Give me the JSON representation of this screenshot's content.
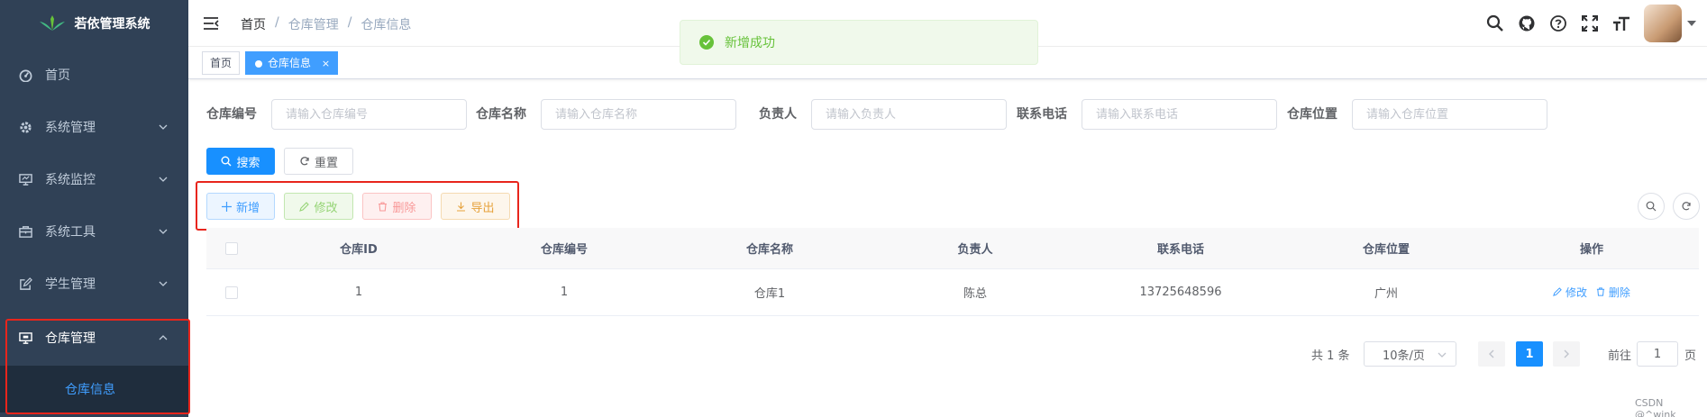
{
  "app": {
    "title": "若依管理系统"
  },
  "sidebar": {
    "items": [
      {
        "label": "首页",
        "icon": "dashboard-icon"
      },
      {
        "label": "系统管理",
        "icon": "gear-icon"
      },
      {
        "label": "系统监控",
        "icon": "monitor-icon"
      },
      {
        "label": "系统工具",
        "icon": "toolbox-icon"
      },
      {
        "label": "学生管理",
        "icon": "edit-icon"
      },
      {
        "label": "仓库管理",
        "icon": "monitor-icon"
      }
    ],
    "submenu": {
      "label": "仓库信息"
    }
  },
  "header": {
    "breadcrumb": [
      "首页",
      "仓库管理",
      "仓库信息"
    ],
    "separator": "/"
  },
  "tags": [
    {
      "label": "首页"
    },
    {
      "label": "仓库信息",
      "close": "×"
    }
  ],
  "toast": {
    "message": "新增成功"
  },
  "search": {
    "fields": [
      {
        "label": "仓库编号",
        "placeholder": "请输入仓库编号"
      },
      {
        "label": "仓库名称",
        "placeholder": "请输入仓库名称"
      },
      {
        "label": "负责人",
        "placeholder": "请输入负责人"
      },
      {
        "label": "联系电话",
        "placeholder": "请输入联系电话"
      },
      {
        "label": "仓库位置",
        "placeholder": "请输入仓库位置"
      }
    ],
    "search_label": "搜索",
    "reset_label": "重置"
  },
  "toolbar": {
    "add_label": "新增",
    "edit_label": "修改",
    "delete_label": "删除",
    "export_label": "导出"
  },
  "table": {
    "columns": [
      "仓库ID",
      "仓库编号",
      "仓库名称",
      "负责人",
      "联系电话",
      "仓库位置",
      "操作"
    ],
    "rows": [
      {
        "id": "1",
        "code": "1",
        "name": "仓库1",
        "manager": "陈总",
        "phone": "13725648596",
        "location": "广州",
        "edit": "修改",
        "delete": "删除"
      }
    ]
  },
  "pagination": {
    "total_text": "共 1 条",
    "page_size": "10条/页",
    "current_page": "1",
    "goto_prefix": "前往",
    "goto_value": "1",
    "goto_suffix": "页"
  },
  "watermark": "CSDN @^wink",
  "colors": {
    "sidebar_bg": "#304156",
    "primary": "#1890ff",
    "success": "#67c23a",
    "highlight": "#e8251c"
  }
}
